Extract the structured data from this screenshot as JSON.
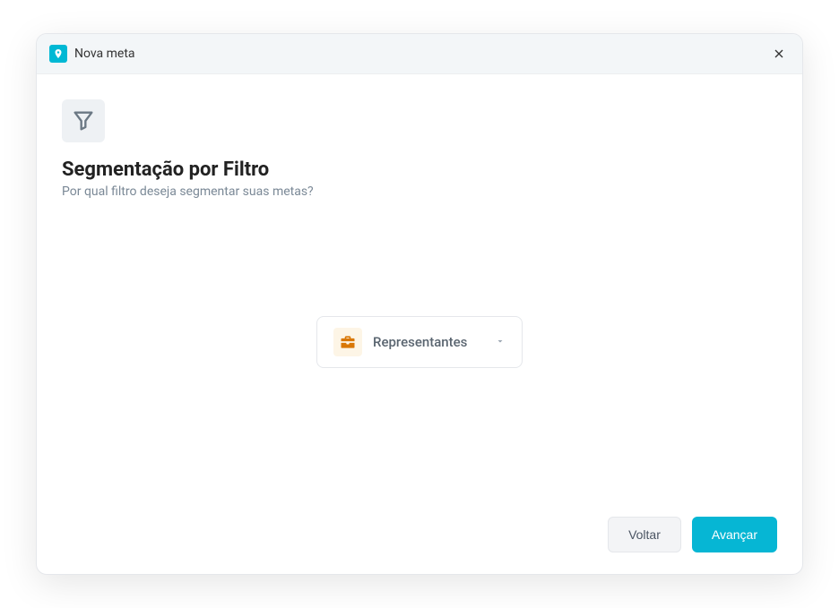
{
  "modal": {
    "title": "Nova meta"
  },
  "content": {
    "heading": "Segmentação por Filtro",
    "subheading": "Por qual filtro deseja segmentar suas metas?"
  },
  "dropdown": {
    "selected_label": "Representantes"
  },
  "footer": {
    "back_label": "Voltar",
    "next_label": "Avançar"
  }
}
